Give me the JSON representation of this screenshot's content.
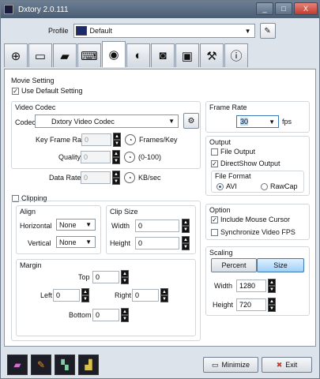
{
  "window": {
    "title": "Dxtory 2.0.111",
    "min": "_",
    "max": "□",
    "close": "X"
  },
  "profile": {
    "label": "Profile",
    "value": "Default",
    "edit_icon": "pencil-icon"
  },
  "tabs": [
    {
      "icon": "crosshair-icon",
      "glyph": "⊕"
    },
    {
      "icon": "monitor-icon",
      "glyph": "▭"
    },
    {
      "icon": "folder-icon",
      "glyph": "▰"
    },
    {
      "icon": "keyboard-icon",
      "glyph": "⌨"
    },
    {
      "icon": "camcorder-icon",
      "glyph": "◉"
    },
    {
      "icon": "speaker-icon",
      "glyph": "◐"
    },
    {
      "icon": "camera-icon",
      "glyph": "◙"
    },
    {
      "icon": "chip-icon",
      "glyph": "▣"
    },
    {
      "icon": "tools-icon",
      "glyph": "⚒"
    },
    {
      "icon": "info-icon",
      "glyph": "ⓘ"
    }
  ],
  "movie": {
    "title": "Movie Setting",
    "use_default": "Use Default Setting",
    "video_codec_title": "Video Codec",
    "codec_label": "Codec",
    "codec_value": "Dxtory Video Codec",
    "keyframe_label": "Key Frame Rate",
    "keyframe_value": "0",
    "keyframe_unit": "Frames/Key",
    "quality_label": "Quality",
    "quality_value": "0",
    "quality_unit": "(0-100)",
    "datarate_label": "Data Rate",
    "datarate_value": "0",
    "datarate_unit": "KB/sec"
  },
  "clipping": {
    "label": "Clipping",
    "align_title": "Align",
    "horizontal_label": "Horizontal",
    "horizontal_value": "None",
    "vertical_label": "Vertical",
    "vertical_value": "None",
    "clipsize_title": "Clip Size",
    "width_label": "Width",
    "width_value": "0",
    "height_label": "Height",
    "height_value": "0",
    "margin_title": "Margin",
    "top_label": "Top",
    "top_value": "0",
    "left_label": "Left",
    "left_value": "0",
    "right_label": "Right",
    "right_value": "0",
    "bottom_label": "Bottom",
    "bottom_value": "0"
  },
  "framerate": {
    "title": "Frame Rate",
    "value": "30",
    "unit": "fps"
  },
  "output": {
    "title": "Output",
    "file_output": "File Output",
    "directshow_output": "DirectShow Output",
    "format_title": "File Format",
    "avi": "AVI",
    "rawcap": "RawCap"
  },
  "option": {
    "title": "Option",
    "include_cursor": "Include Mouse Cursor",
    "sync_fps": "Synchronize Video FPS"
  },
  "scaling": {
    "title": "Scaling",
    "percent": "Percent",
    "size": "Size",
    "width_label": "Width",
    "width_value": "1280",
    "height_label": "Height",
    "height_value": "720"
  },
  "footer": {
    "minimize": "Minimize",
    "exit": "Exit"
  },
  "colors": {
    "title_bar": "#4a5d73",
    "selected": "#9fd0f8",
    "close": "#c23b2e"
  }
}
